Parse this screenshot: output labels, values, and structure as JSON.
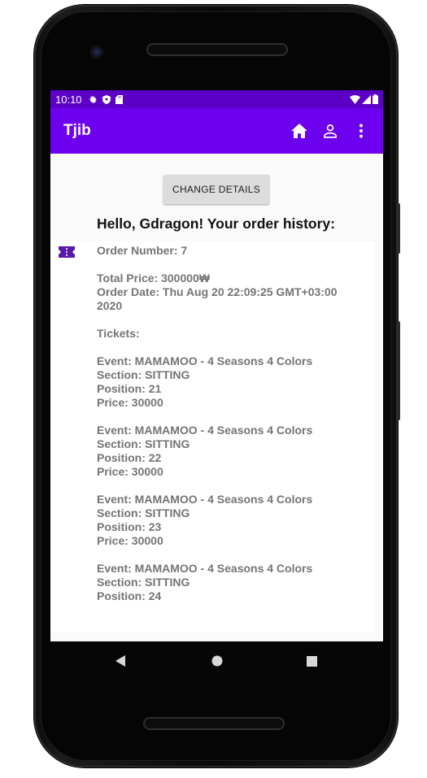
{
  "status_bar": {
    "time": "10:10"
  },
  "app_bar": {
    "title": "Tjib",
    "actions": [
      "home-icon",
      "person-icon",
      "more-vert-icon"
    ]
  },
  "main": {
    "change_details_label": "CHANGE DETAILS",
    "greeting": "Hello, Gdragon! Your order history:"
  },
  "order": {
    "order_number": "Order Number: 7",
    "total_price": "Total Price: 300000₩",
    "order_date_line1": "Order Date: Thu Aug 20 22:09:25 GMT+03:00",
    "order_date_line2": "2020",
    "tickets_label": "Tickets:",
    "tickets": [
      {
        "event": "Event: MAMAMOO - 4 Seasons 4 Colors",
        "section": "Section: SITTING",
        "position": "Position: 21",
        "price": "Price: 30000"
      },
      {
        "event": "Event: MAMAMOO - 4 Seasons 4 Colors",
        "section": "Section: SITTING",
        "position": "Position: 22",
        "price": "Price: 30000"
      },
      {
        "event": "Event: MAMAMOO - 4 Seasons 4 Colors",
        "section": "Section: SITTING",
        "position": "Position: 23",
        "price": "Price: 30000"
      },
      {
        "event": "Event: MAMAMOO - 4 Seasons 4 Colors",
        "section": "Section: SITTING",
        "position": "Position: 24"
      }
    ]
  },
  "colors": {
    "primary": "#6d00ee",
    "primary_dark": "#5c00c7",
    "ticket_icon": "#5a18a8"
  },
  "nav_bar": {
    "buttons": [
      "back-icon",
      "home-circle-icon",
      "recents-icon"
    ]
  }
}
